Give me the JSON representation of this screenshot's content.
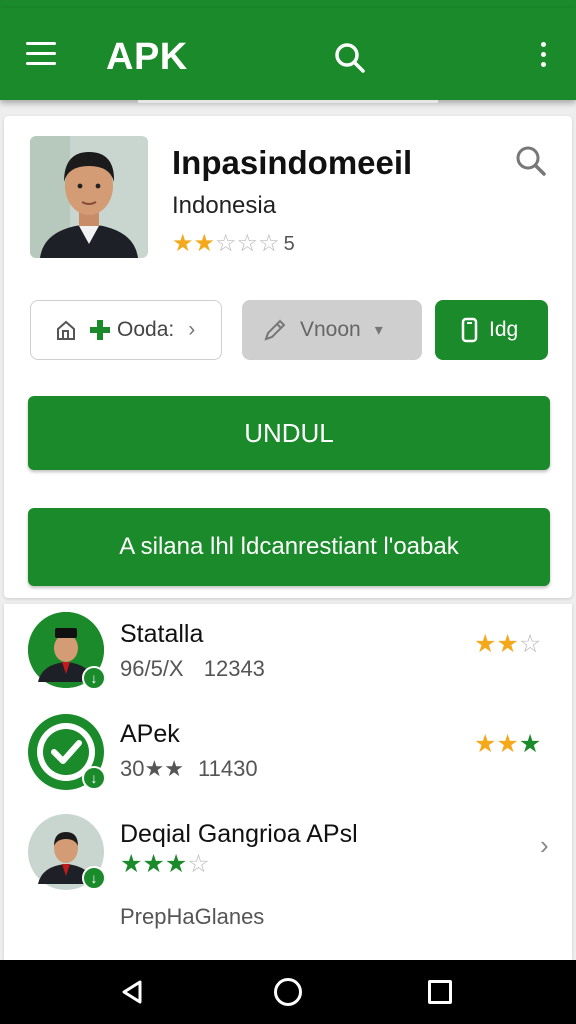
{
  "app_bar": {
    "title": "APK",
    "menu_icon": "hamburger-menu-icon",
    "search_icon": "search-icon",
    "more_icon": "more-vert-icon",
    "color": "#1a8a2a"
  },
  "app": {
    "name": "Inpasindomeeil",
    "country": "Indonesia",
    "rating": 2,
    "rating_max": 5,
    "rating_count": "5",
    "avatar_icon": "profile-photo"
  },
  "chips": {
    "download_label": "Ooda:",
    "version_label": "Vnoon",
    "info_label": "Idg"
  },
  "buttons": {
    "primary_label": "UNDUL",
    "secondary_label": "A silana lhl ldcanrestiant l'oabak"
  },
  "list": [
    {
      "title": "Statalla",
      "sub_a": "96/5/X",
      "sub_b": "12343",
      "rating": 2,
      "star_color": "gold"
    },
    {
      "title": "APek",
      "sub_a": "30★★",
      "sub_b": "11430",
      "rating": 3,
      "star_color": "mixed"
    },
    {
      "title": "Deqial Gangrioa APsl",
      "rating": 3,
      "star_color": "green",
      "extra": "PrepHaGlanes"
    }
  ],
  "nav": {
    "back_icon": "back-icon",
    "home_icon": "home-icon",
    "recent_icon": "recent-apps-icon"
  }
}
